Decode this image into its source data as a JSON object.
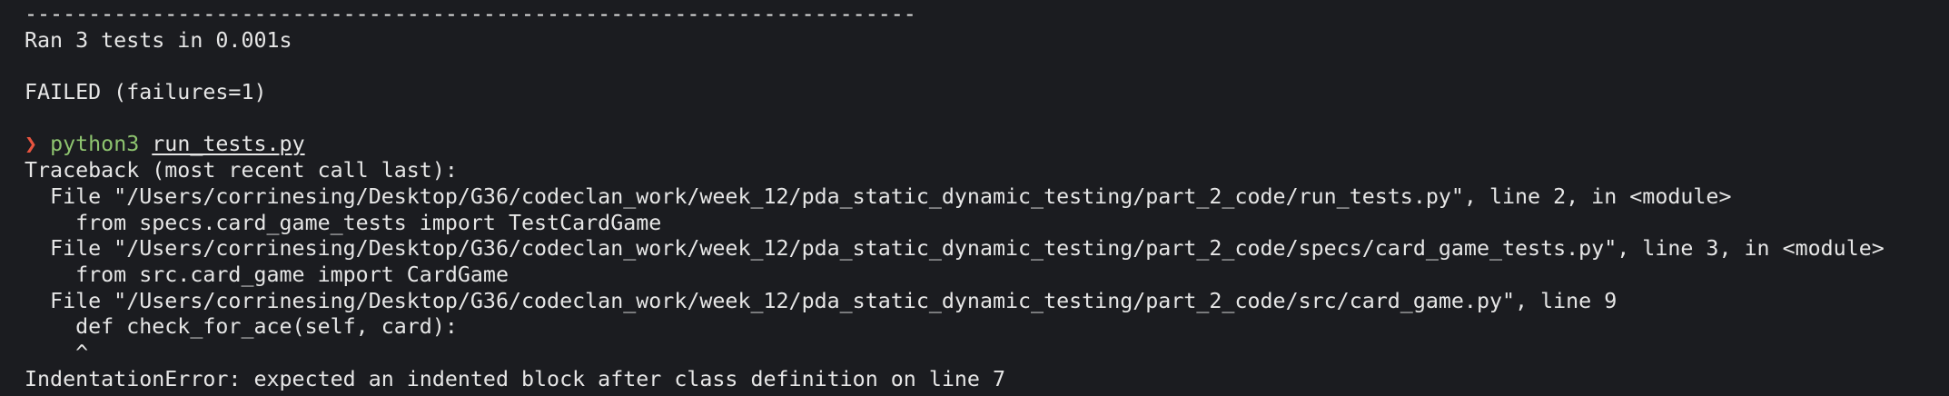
{
  "terminal": {
    "separator": "----------------------------------------------------------------------",
    "ran_line": "Ran 3 tests in 0.001s",
    "failed_line": "FAILED (failures=1)",
    "prompt": {
      "glyph": "❯",
      "command": "python3",
      "argument": "run_tests.py"
    },
    "traceback_header": "Traceback (most recent call last):",
    "traceback": [
      "  File \"/Users/corrinesing/Desktop/G36/codeclan_work/week_12/pda_static_dynamic_testing/part_2_code/run_tests.py\", line 2, in <module>",
      "    from specs.card_game_tests import TestCardGame",
      "  File \"/Users/corrinesing/Desktop/G36/codeclan_work/week_12/pda_static_dynamic_testing/part_2_code/specs/card_game_tests.py\", line 3, in <module>",
      "    from src.card_game import CardGame",
      "  File \"/Users/corrinesing/Desktop/G36/codeclan_work/week_12/pda_static_dynamic_testing/part_2_code/src/card_game.py\", line 9",
      "    def check_for_ace(self, card):",
      "    ^"
    ],
    "error_line": "IndentationError: expected an indented block after class definition on line 7"
  },
  "colors": {
    "background": "#1b1c20",
    "text": "#e6e6e6",
    "prompt_glyph": "#e8543f",
    "command": "#8ec46f"
  }
}
